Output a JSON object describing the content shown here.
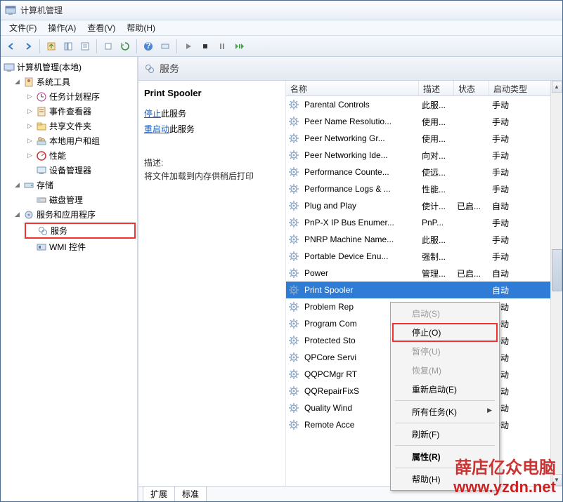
{
  "title": "计算机管理",
  "menu": [
    "文件(F)",
    "操作(A)",
    "查看(V)",
    "帮助(H)"
  ],
  "tree": {
    "root": "计算机管理(本地)",
    "g1": "系统工具",
    "g1_1": "任务计划程序",
    "g1_2": "事件查看器",
    "g1_3": "共享文件夹",
    "g1_4": "本地用户和组",
    "g1_5": "性能",
    "g1_6": "设备管理器",
    "g2": "存储",
    "g2_1": "磁盘管理",
    "g3": "服务和应用程序",
    "g3_1": "服务",
    "g3_2": "WMI 控件"
  },
  "main_header": "服务",
  "detail": {
    "title": "Print Spooler",
    "stop_prefix": "停止",
    "stop_suffix": "此服务",
    "restart_prefix": "重启动",
    "restart_suffix": "此服务",
    "desc_label": "描述:",
    "desc_text": "将文件加载到内存供稍后打印"
  },
  "columns": {
    "name": "名称",
    "desc": "描述",
    "state": "状态",
    "start": "启动类型"
  },
  "services": [
    {
      "name": "Parental Controls",
      "desc": "此服...",
      "state": "",
      "start": "手动"
    },
    {
      "name": "Peer Name Resolutio...",
      "desc": "使用...",
      "state": "",
      "start": "手动"
    },
    {
      "name": "Peer Networking Gr...",
      "desc": "使用...",
      "state": "",
      "start": "手动"
    },
    {
      "name": "Peer Networking Ide...",
      "desc": "向对...",
      "state": "",
      "start": "手动"
    },
    {
      "name": "Performance Counte...",
      "desc": "使远...",
      "state": "",
      "start": "手动"
    },
    {
      "name": "Performance Logs & ...",
      "desc": "性能...",
      "state": "",
      "start": "手动"
    },
    {
      "name": "Plug and Play",
      "desc": "使计...",
      "state": "已启...",
      "start": "自动"
    },
    {
      "name": "PnP-X IP Bus Enumer...",
      "desc": "PnP...",
      "state": "",
      "start": "手动"
    },
    {
      "name": "PNRP Machine Name...",
      "desc": "此服...",
      "state": "",
      "start": "手动"
    },
    {
      "name": "Portable Device Enu...",
      "desc": "强制...",
      "state": "",
      "start": "手动"
    },
    {
      "name": "Power",
      "desc": "管理...",
      "state": "已启...",
      "start": "自动"
    },
    {
      "name": "Print Spooler",
      "desc": "",
      "state": "",
      "start": "自动",
      "selected": true
    },
    {
      "name": "Problem Rep",
      "desc": "",
      "state": "",
      "start": "手动"
    },
    {
      "name": "Program Com",
      "desc": "",
      "state": "",
      "start": "手动"
    },
    {
      "name": "Protected Sto",
      "desc": "",
      "state": "",
      "start": "手动"
    },
    {
      "name": "QPCore Servi",
      "desc": "",
      "state": "",
      "start": "自动"
    },
    {
      "name": "QQPCMgr RT",
      "desc": "",
      "state": "",
      "start": "自动"
    },
    {
      "name": "QQRepairFixS",
      "desc": "",
      "state": "",
      "start": "自动"
    },
    {
      "name": "Quality Wind",
      "desc": "",
      "state": "",
      "start": "手动"
    },
    {
      "name": "Remote Acce",
      "desc": "",
      "state": "",
      "start": "手动"
    }
  ],
  "ctx": {
    "start": "启动(S)",
    "stop": "停止(O)",
    "pause": "暂停(U)",
    "resume": "恢复(M)",
    "restart": "重新启动(E)",
    "alltasks": "所有任务(K)",
    "refresh": "刷新(F)",
    "properties": "属性(R)",
    "help": "帮助(H)"
  },
  "tabs": {
    "extended": "扩展",
    "standard": "标准"
  },
  "watermark": {
    "line1": "薛店亿众电脑",
    "line2": "www.yzdn.net"
  }
}
